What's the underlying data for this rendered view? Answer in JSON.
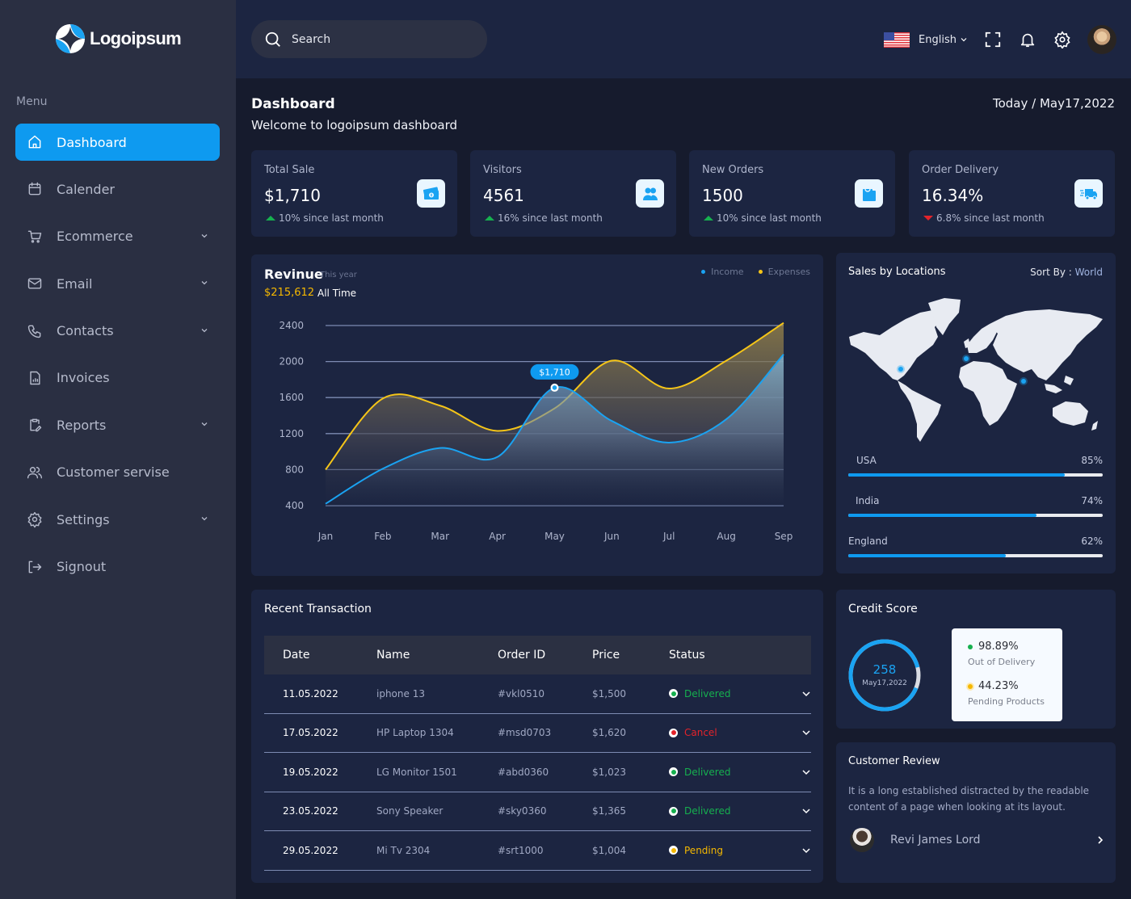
{
  "brand": {
    "name": "Logoipsum",
    "accent": "#0e9af0"
  },
  "sidebar": {
    "menu_label": "Menu",
    "items": [
      {
        "label": "Dashboard",
        "icon": "home-icon",
        "active": true,
        "expandable": false
      },
      {
        "label": "Calender",
        "icon": "calendar-icon",
        "active": false,
        "expandable": false
      },
      {
        "label": "Ecommerce",
        "icon": "cart-icon",
        "active": false,
        "expandable": true
      },
      {
        "label": "Email",
        "icon": "mail-icon",
        "active": false,
        "expandable": true
      },
      {
        "label": "Contacts",
        "icon": "phone-icon",
        "active": false,
        "expandable": true
      },
      {
        "label": "Invoices",
        "icon": "invoice-icon",
        "active": false,
        "expandable": false
      },
      {
        "label": "Reports",
        "icon": "clipboard-edit-icon",
        "active": false,
        "expandable": true
      },
      {
        "label": "Customer servise",
        "icon": "users-icon",
        "active": false,
        "expandable": false
      },
      {
        "label": "Settings",
        "icon": "gear-icon",
        "active": false,
        "expandable": true
      },
      {
        "label": "Signout",
        "icon": "signout-icon",
        "active": false,
        "expandable": false
      }
    ]
  },
  "topbar": {
    "search_placeholder": "Search",
    "language": "English",
    "icons": [
      "fullscreen-icon",
      "bell-icon",
      "gear-icon"
    ]
  },
  "header": {
    "title": "Dashboard",
    "subtitle": "Welcome to logoipsum dashboard",
    "today": "Today / May17,2022"
  },
  "stats": [
    {
      "label": "Total Sale",
      "value": "$1,710",
      "change": "10% since last month",
      "trend": "up",
      "icon": "money-icon"
    },
    {
      "label": "Visitors",
      "value": "4561",
      "change": "16% since last month",
      "trend": "up",
      "icon": "users-icon"
    },
    {
      "label": "New Orders",
      "value": "1500",
      "change": "10% since last month",
      "trend": "up",
      "icon": "shopping-bag-icon"
    },
    {
      "label": "Order Delivery",
      "value": "16.34%",
      "change": "6.8% since last month",
      "trend": "down",
      "icon": "truck-icon"
    }
  ],
  "revenue": {
    "title": "Revinue",
    "period": "This year",
    "total": "$215,612",
    "total_label": "All Time",
    "tooltip": "$1,710"
  },
  "chart_data": {
    "type": "area",
    "title": "Revinue",
    "categories": [
      "Jan",
      "Feb",
      "Mar",
      "Apr",
      "May",
      "Jun",
      "Jul",
      "Aug",
      "Sep"
    ],
    "series": [
      {
        "name": "Income",
        "color": "#1aa3f2",
        "values": [
          420,
          810,
          1040,
          940,
          1710,
          1340,
          1100,
          1360,
          2080
        ]
      },
      {
        "name": "Expenses",
        "color": "#f5c518",
        "values": [
          800,
          1590,
          1510,
          1230,
          1480,
          2010,
          1700,
          2010,
          2430
        ]
      }
    ],
    "yticks": [
      400,
      800,
      1200,
      1600,
      2000,
      2400
    ],
    "ylim": [
      400,
      2400
    ],
    "highlight": {
      "series": "Income",
      "category": "May",
      "label": "$1,710"
    },
    "legend": "top-right",
    "grid": true
  },
  "sales_by_location": {
    "title": "Sales by Locations",
    "sort_label": "Sort By :",
    "sort_value": "World",
    "locations": [
      {
        "name": "USA",
        "percent": 85
      },
      {
        "name": "India",
        "percent": 74
      },
      {
        "name": "England",
        "percent": 62
      }
    ]
  },
  "transactions": {
    "title": "Recent Transaction",
    "columns": [
      "Date",
      "Name",
      "Order ID",
      "Price",
      "Status"
    ],
    "rows": [
      {
        "date": "11.05.2022",
        "name": "iphone 13",
        "order_id": "#vkl0510",
        "price": "$1,500",
        "status": "Delivered",
        "status_color": "#16b04f"
      },
      {
        "date": "17.05.2022",
        "name": "HP Laptop 1304",
        "order_id": "#msd0703",
        "price": "$1,620",
        "status": "Cancel",
        "status_color": "#e4232a"
      },
      {
        "date": "19.05.2022",
        "name": "LG Monitor 1501",
        "order_id": "#abd0360",
        "price": "$1,023",
        "status": "Delivered",
        "status_color": "#16b04f"
      },
      {
        "date": "23.05.2022",
        "name": "Sony Speaker",
        "order_id": "#sky0360",
        "price": "$1,365",
        "status": "Delivered",
        "status_color": "#16b04f"
      },
      {
        "date": "29.05.2022",
        "name": "Mi Tv 2304",
        "order_id": "#srt1000",
        "price": "$1,004",
        "status": "Pending",
        "status_color": "#f5b800"
      }
    ]
  },
  "credit_score": {
    "title": "Credit Score",
    "score": "258",
    "date": "May17,2022",
    "ring_fraction": 0.9,
    "items": [
      {
        "value": "98.89%",
        "label": "Out of Delivery",
        "color": "#16b04f"
      },
      {
        "value": "44.23%",
        "label": "Pending Products",
        "color": "#f5b800"
      }
    ]
  },
  "customer_review": {
    "title": "Customer Review",
    "text": "It is a long established  distracted by the readable content of a page when looking at its layout.",
    "reviewer": "Revi James Lord"
  }
}
